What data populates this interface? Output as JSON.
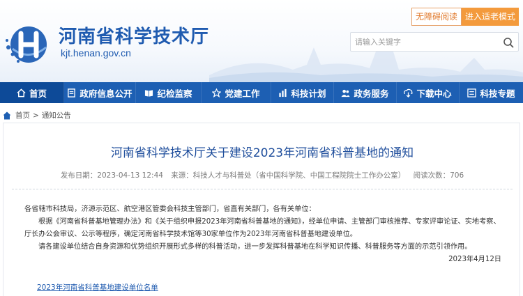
{
  "header": {
    "site_title": "河南省科学技术厅",
    "site_domain": "kjt.henan.gov.cn",
    "accessibility_label": "无障碍阅读",
    "elder_mode_label": "进入适老模式",
    "search_placeholder": "请输入关键字"
  },
  "nav": {
    "items": [
      {
        "label": "首页",
        "icon": "home-icon"
      },
      {
        "label": "政府信息公开",
        "icon": "document-icon"
      },
      {
        "label": "纪检监察",
        "icon": "book-icon"
      },
      {
        "label": "党建工作",
        "icon": "star-icon"
      },
      {
        "label": "科技计划",
        "icon": "chart-icon"
      },
      {
        "label": "政务服务",
        "icon": "people-icon"
      },
      {
        "label": "下载中心",
        "icon": "download-icon"
      },
      {
        "label": "科技专题",
        "icon": "list-icon"
      }
    ],
    "active_index": 0
  },
  "breadcrumb": {
    "home": "首页",
    "separator": ">",
    "current": "通知公告"
  },
  "article": {
    "title": "河南省科学技术厅关于建设2023年河南省科普基地的通知",
    "meta": {
      "publish_date": "发布日期：2023-04-13 12:44",
      "source": "来源：科技人才与科普处（省中国科学院、中国工程院院士工作办公室）",
      "views": "阅读次数：706"
    },
    "greeting": "各省辖市科技局，济源示范区、航空港区管委会科技主管部门，省直有关部门，各有关单位：",
    "paragraph1": "根据《河南省科普基地管理办法》和《关于组织申报2023年河南省科普基地的通知》，经单位申请、主管部门审核推荐、专家评审论证、实地考察、厅长办公会审议、公示等程序，确定河南省科学技术馆等30家单位作为2023年河南省科普基地建设单位。",
    "paragraph2": "请各建设单位结合自身资源和优势组织开展形式多样的科普活动，进一步发挥科普基地在科学知识传播、科普服务等方面的示范引领作用。",
    "date": "2023年4月12日",
    "attachment": "2023年河南省科普基地建设单位名单"
  },
  "colors": {
    "primary_blue": "#1d5fb3",
    "active_nav": "#0d4a98",
    "title_blue": "#1f4e9c",
    "orange": "#f39a3c"
  }
}
